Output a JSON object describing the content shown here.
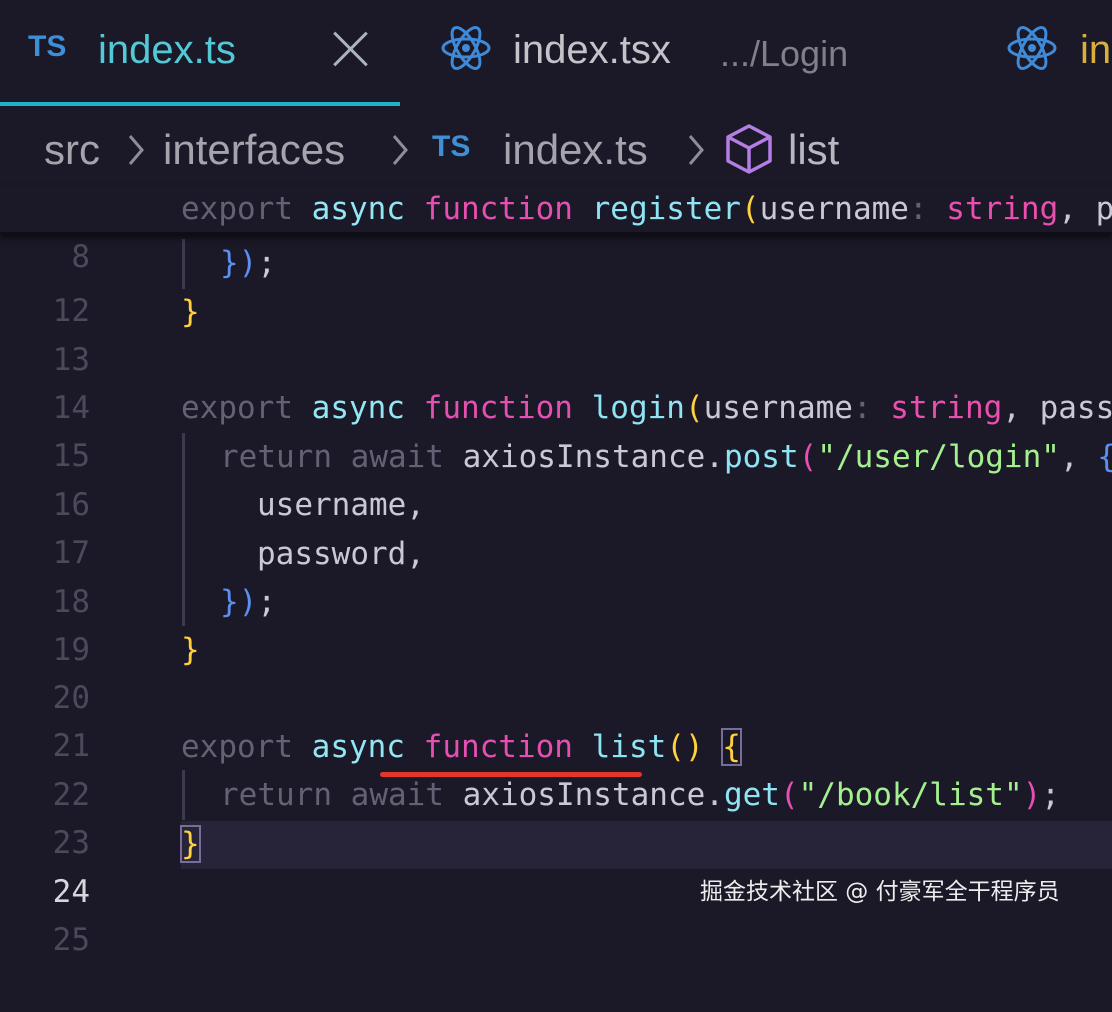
{
  "tabs": [
    {
      "icon": "TS",
      "label": "index.ts",
      "active": true
    },
    {
      "icon": "react-icon",
      "label": "index.tsx",
      "description": ".../Login"
    },
    {
      "icon": "react-icon",
      "label": "in"
    }
  ],
  "breadcrumb": {
    "items": [
      "src",
      "interfaces",
      "index.ts",
      "list"
    ],
    "file_icon": "TS"
  },
  "sticky": {
    "line": "8",
    "t1": "export",
    "t2": "async",
    "t3": "function",
    "t4": "register",
    "t5": "(",
    "t6": "username",
    "t7": ":",
    "t8": "string",
    "t9": ", p"
  },
  "lines": {
    "l12": {
      "n": "12",
      "a": "})",
      "b": ";"
    },
    "l13": {
      "n": "13",
      "a": "}"
    },
    "l14": {
      "n": "14"
    },
    "l15": {
      "n": "15",
      "t1": "export",
      "t2": "async",
      "t3": "function",
      "t4": "login",
      "t5": "(",
      "t6": "username",
      "t7": ":",
      "t8": "string",
      "t9": ", pass"
    },
    "l16": {
      "n": "16",
      "t1": "return",
      "t2": "await",
      "t3": "axiosInstance",
      "t4": ".",
      "t5": "post",
      "t6": "(",
      "t7": "\"/user/login\"",
      "t8": ", ",
      "t9": "{"
    },
    "l17": {
      "n": "17",
      "t1": "username,"
    },
    "l18": {
      "n": "18",
      "t1": "password,"
    },
    "l19": {
      "n": "19",
      "a": "})",
      "b": ";"
    },
    "l20": {
      "n": "20",
      "a": "}"
    },
    "l21": {
      "n": "21"
    },
    "l22": {
      "n": "22",
      "t1": "export",
      "t2": "async",
      "t3": "function",
      "t4": "list",
      "t5": "()",
      "t6": "{"
    },
    "l23": {
      "n": "23",
      "t1": "return",
      "t2": "await",
      "t3": "axiosInstance",
      "t4": ".",
      "t5": "get",
      "t6": "(",
      "t7": "\"/book/list\"",
      "t8": ")",
      "t9": ";"
    },
    "l24": {
      "n": "24",
      "a": "}"
    },
    "l25": {
      "n": "25"
    }
  },
  "watermark": "掘金技术社区 @ 付豪军全干程序员",
  "colors": {
    "background": "#1b1827",
    "active_tab_indicator": "#21b4c9",
    "annotation_underline": "#e1362a"
  }
}
